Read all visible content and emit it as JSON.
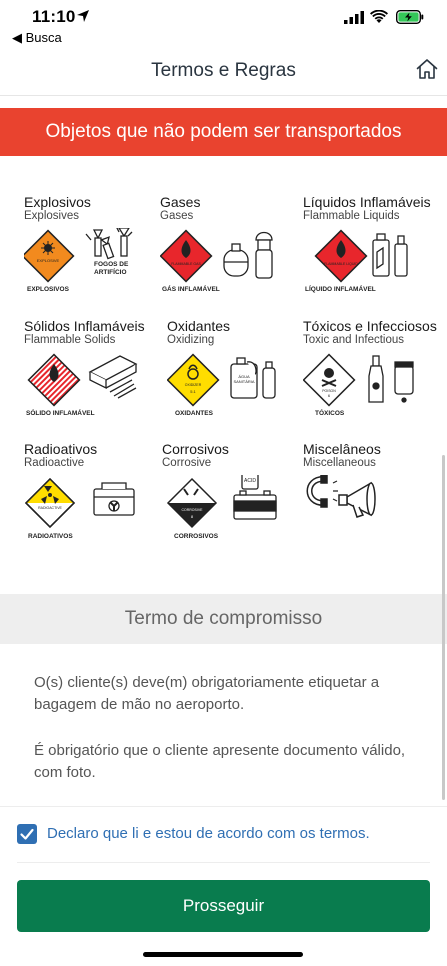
{
  "status_bar": {
    "time": "11:10",
    "back_label": "◀ Busca"
  },
  "header": {
    "title": "Termos e Regras"
  },
  "banner": {
    "text": "Objetos que não podem ser transportados"
  },
  "categories": [
    {
      "name": "Explosivos",
      "sub": "Explosives",
      "labels": [
        "EXPLOSIVOS",
        "FOGOS DE",
        "ARTIFÍCIO",
        "EXPLOSIVE"
      ]
    },
    {
      "name": "Gases",
      "sub": "Gases",
      "labels": [
        "GÁS INFLAMÁVEL",
        "FLAMMABLE GAS"
      ]
    },
    {
      "name": "Líquidos Inflamáveis",
      "sub": "Flammable Liquids",
      "labels": [
        "LÍQUIDO INFLAMÁVEL",
        "FLAMMABLE LIQUID"
      ]
    },
    {
      "name": "Sólidos Inflamáveis",
      "sub": "Flammable Solids",
      "labels": [
        "SÓLIDO INFLAMÁVEL"
      ]
    },
    {
      "name": "Oxidantes",
      "sub": "Oxidizing",
      "labels": [
        "OXIDANTES",
        "ÁGUA",
        "SANITÁRIA",
        "OXIDIZER",
        "5.1"
      ]
    },
    {
      "name": "Tóxicos e Infecciosos",
      "sub": "Toxic and Infectious",
      "labels": [
        "TÓXICOS",
        "POISON",
        "6"
      ]
    },
    {
      "name": "Radioativos",
      "sub": "Radioactive",
      "labels": [
        "RADIOATIVOS",
        "RADIOACTIVE"
      ]
    },
    {
      "name": "Corrosivos",
      "sub": "Corrosive",
      "labels": [
        "CORROSIVOS",
        "CORROSIVE",
        "ACID",
        "8"
      ]
    },
    {
      "name": "Miscelâneos",
      "sub": "Miscellaneous",
      "labels": []
    }
  ],
  "termo": {
    "title": "Termo de compromisso",
    "p1": "O(s) cliente(s) deve(m) obrigatoriamente etiquetar a bagagem de mão no aeroporto.",
    "p2": "É obrigatório que o cliente apresente documento válido, com foto."
  },
  "agreement": {
    "label": "Declaro que li e estou de acordo com os termos.",
    "checked": true
  },
  "actions": {
    "proceed_label": "Prosseguir"
  },
  "colors": {
    "banner": "#e9432f",
    "primary": "#097c4e",
    "link": "#2f6fb3"
  },
  "icons": [
    "location-arrow-icon",
    "signal-icon",
    "wifi-icon",
    "battery-charging-icon",
    "home-icon",
    "checkmark-icon"
  ]
}
